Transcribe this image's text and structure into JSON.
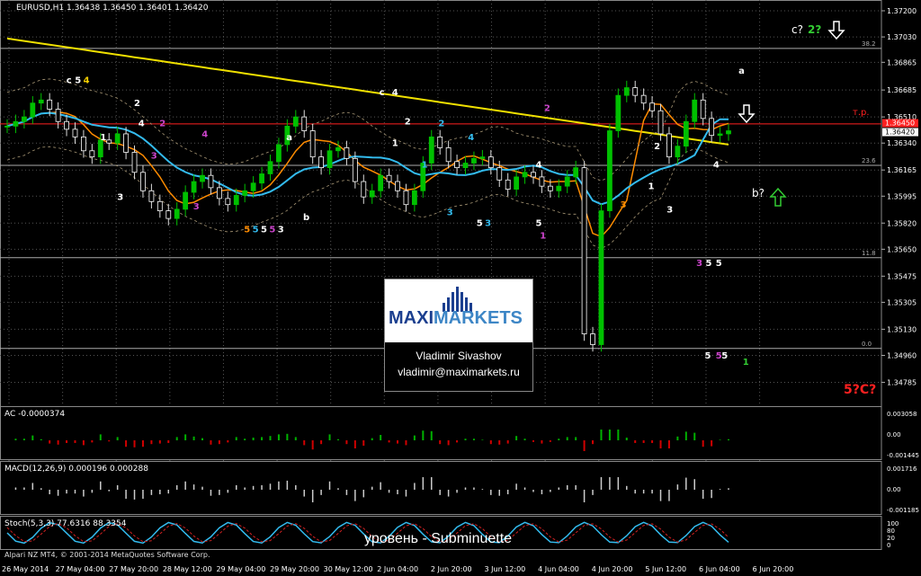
{
  "header": {
    "symbol": "EURUSD,H1",
    "ohlc": "1.36438 1.36450 1.36401 1.36420"
  },
  "indicators": {
    "ac": "AC -0.0000374",
    "macd": "MACD(12,26,9) 0.000196 0.000288",
    "stoch": "Stoch(5,3,3) 77.6316 88.3354",
    "copyright": "Alpari NZ MT4, © 2001-2014 MetaQuotes Software Corp."
  },
  "logo": {
    "brand_part1": "MAXI",
    "brand_part2": "MARKETS",
    "author": "Vladimir Sivashov",
    "email": "vladimir@maximarkets.ru"
  },
  "caption": "уровень - Subminuette",
  "colors": {
    "background": "#000000",
    "bull_candle": "#00c000",
    "bear_candle": "#ffffff",
    "sma_long": "#f0e000",
    "ema_fast": "#ff8c00",
    "ema_mid": "#33bbee",
    "resistance": "#ff2020",
    "grid": "#ffffff"
  },
  "chart_data": {
    "type": "candlestick",
    "symbol": "EURUSD",
    "timeframe": "H1",
    "ylim": [
      1.3463,
      1.3727
    ],
    "price_ticks": [
      "1.37200",
      "1.37030",
      "1.36865",
      "1.36685",
      "1.36510",
      "1.36340",
      "1.36165",
      "1.35995",
      "1.35820",
      "1.35650",
      "1.35475",
      "1.35305",
      "1.35130",
      "1.34960",
      "1.34785"
    ],
    "current_price": "1.36420",
    "current_price_box": "1.36450",
    "time_labels": [
      "26 May 2014",
      "27 May 04:00",
      "27 May 20:00",
      "28 May 12:00",
      "29 May 04:00",
      "29 May 20:00",
      "30 May 12:00",
      "2 Jun 04:00",
      "2 Jun 20:00",
      "3 Jun 12:00",
      "4 Jun 04:00",
      "4 Jun 20:00",
      "5 Jun 12:00",
      "6 Jun 04:00",
      "6 Jun 20:00"
    ],
    "fib_levels": [
      {
        "label": "38.2",
        "price": 1.36955
      },
      {
        "label": "23.6",
        "price": 1.36195
      },
      {
        "label": "11.8",
        "price": 1.35595
      },
      {
        "label": "0.0",
        "price": 1.35005
      }
    ],
    "horizontal_levels": [
      {
        "label": "т.р.",
        "price": 1.36465
      }
    ],
    "close_series": [
      1.3645,
      1.3648,
      1.3651,
      1.366,
      1.3662,
      1.3656,
      1.3648,
      1.3643,
      1.3638,
      1.3629,
      1.3625,
      1.3636,
      1.3634,
      1.364,
      1.3628,
      1.3615,
      1.3603,
      1.3596,
      1.359,
      1.3585,
      1.3591,
      1.3602,
      1.3609,
      1.3613,
      1.3605,
      1.3598,
      1.3594,
      1.36,
      1.3603,
      1.3608,
      1.3614,
      1.3622,
      1.3633,
      1.3645,
      1.3651,
      1.3642,
      1.3625,
      1.3618,
      1.3629,
      1.3631,
      1.3624,
      1.3609,
      1.3599,
      1.3603,
      1.3613,
      1.3609,
      1.3603,
      1.3594,
      1.3603,
      1.3621,
      1.3638,
      1.3631,
      1.3622,
      1.3618,
      1.3621,
      1.3624,
      1.3625,
      1.3618,
      1.361,
      1.3604,
      1.3612,
      1.3615,
      1.3612,
      1.3606,
      1.3603,
      1.3606,
      1.3612,
      1.3618,
      1.351,
      1.3503,
      1.359,
      1.3642,
      1.3665,
      1.367,
      1.3665,
      1.366,
      1.3655,
      1.364,
      1.3625,
      1.3632,
      1.3648,
      1.3662,
      1.365,
      1.3639,
      1.364,
      1.3642
    ],
    "wave_labels": [
      {
        "text": "c",
        "color": "#ffffff",
        "price": 1.3673,
        "at": 0.07
      },
      {
        "text": "5",
        "color": "#ffffff",
        "price": 1.3673,
        "at": 0.08
      },
      {
        "text": "4",
        "color": "#f5d000",
        "price": 1.3673,
        "at": 0.09
      },
      {
        "text": "2",
        "color": "#ffffff",
        "price": 1.3658,
        "at": 0.15
      },
      {
        "text": "1",
        "color": "#ffffff",
        "price": 1.3636,
        "at": 0.11
      },
      {
        "text": "3",
        "color": "#ffffff",
        "price": 1.3597,
        "at": 0.13
      },
      {
        "text": "4",
        "color": "#ffffff",
        "price": 1.3645,
        "at": 0.155
      },
      {
        "text": "2",
        "color": "#cc44cc",
        "price": 1.3645,
        "at": 0.18
      },
      {
        "text": "3",
        "color": "#cc44cc",
        "price": 1.3624,
        "at": 0.17
      },
      {
        "text": "4",
        "color": "#cc44cc",
        "price": 1.3638,
        "at": 0.23
      },
      {
        "text": "3",
        "color": "#cc44cc",
        "price": 1.3591,
        "at": 0.22
      },
      {
        "text": "a",
        "color": "#ffffff",
        "price": 1.3636,
        "at": 0.33
      },
      {
        "text": "b",
        "color": "#ffffff",
        "price": 1.3584,
        "at": 0.35
      },
      {
        "text": "5",
        "color": "#ff8c00",
        "price": 1.3576,
        "at": 0.28
      },
      {
        "text": "5",
        "color": "#33bbee",
        "price": 1.3576,
        "at": 0.29
      },
      {
        "text": "5",
        "color": "#ffffff",
        "price": 1.3576,
        "at": 0.3
      },
      {
        "text": "5",
        "color": "#cc44cc",
        "price": 1.3576,
        "at": 0.31
      },
      {
        "text": "3",
        "color": "#ffffff",
        "price": 1.3576,
        "at": 0.32
      },
      {
        "text": "c",
        "color": "#ffffff",
        "price": 1.3665,
        "at": 0.44
      },
      {
        "text": "4",
        "color": "#ffffff",
        "price": 1.3665,
        "at": 0.455
      },
      {
        "text": "2",
        "color": "#ffffff",
        "price": 1.3646,
        "at": 0.47
      },
      {
        "text": "1",
        "color": "#ffffff",
        "price": 1.3632,
        "at": 0.455
      },
      {
        "text": "2",
        "color": "#33bbee",
        "price": 1.3645,
        "at": 0.51
      },
      {
        "text": "4",
        "color": "#33bbee",
        "price": 1.3636,
        "at": 0.545
      },
      {
        "text": "1",
        "color": "#33bbee",
        "price": 1.3618,
        "at": 0.49
      },
      {
        "text": "3",
        "color": "#33bbee",
        "price": 1.3587,
        "at": 0.52
      },
      {
        "text": "5",
        "color": "#ffffff",
        "price": 1.358,
        "at": 0.555
      },
      {
        "text": "3",
        "color": "#33bbee",
        "price": 1.358,
        "at": 0.565
      },
      {
        "text": "2",
        "color": "#cc44cc",
        "price": 1.3655,
        "at": 0.635
      },
      {
        "text": "4",
        "color": "#ffffff",
        "price": 1.3618,
        "at": 0.625
      },
      {
        "text": "5",
        "color": "#ffffff",
        "price": 1.358,
        "at": 0.625
      },
      {
        "text": "1",
        "color": "#cc44cc",
        "price": 1.3572,
        "at": 0.63
      },
      {
        "text": "2",
        "color": "#ffffff",
        "price": 1.363,
        "at": 0.765
      },
      {
        "text": "1",
        "color": "#ffffff",
        "price": 1.3604,
        "at": 0.758
      },
      {
        "text": "3",
        "color": "#ff8c00",
        "price": 1.3592,
        "at": 0.725
      },
      {
        "text": "3",
        "color": "#ffffff",
        "price": 1.3589,
        "at": 0.78
      },
      {
        "text": "4",
        "color": "#ffffff",
        "price": 1.3618,
        "at": 0.835
      },
      {
        "text": "3",
        "color": "#cc44cc",
        "price": 1.3554,
        "at": 0.815
      },
      {
        "text": "5",
        "color": "#ffffff",
        "price": 1.3554,
        "at": 0.826
      },
      {
        "text": "5",
        "color": "#ffffff",
        "price": 1.3554,
        "at": 0.838
      },
      {
        "text": "a",
        "color": "#ffffff",
        "price": 1.3679,
        "at": 0.865
      },
      {
        "text": "5",
        "color": "#ffffff",
        "price": 1.3494,
        "at": 0.825
      },
      {
        "text": "5",
        "color": "#cc44cc",
        "price": 1.3494,
        "at": 0.838
      },
      {
        "text": "5",
        "color": "#ffffff",
        "price": 1.3494,
        "at": 0.845
      },
      {
        "text": "1",
        "color": "#33cc33",
        "price": 1.349,
        "at": 0.87
      }
    ],
    "forecast_labels": [
      {
        "text": "c?",
        "color": "#ffffff"
      },
      {
        "text": "2?",
        "color": "#33cc33"
      },
      {
        "text": "b?",
        "color": "#ffffff"
      },
      {
        "text": "5?C?",
        "color": "#ff2020"
      }
    ],
    "ac_ticks": [
      "0.003058",
      "0.00",
      "-0.001445"
    ],
    "macd_ticks": [
      "0.001716",
      "0.00",
      "-0.001185"
    ],
    "stoch_ticks": [
      "100",
      "80",
      "20",
      "0"
    ]
  }
}
